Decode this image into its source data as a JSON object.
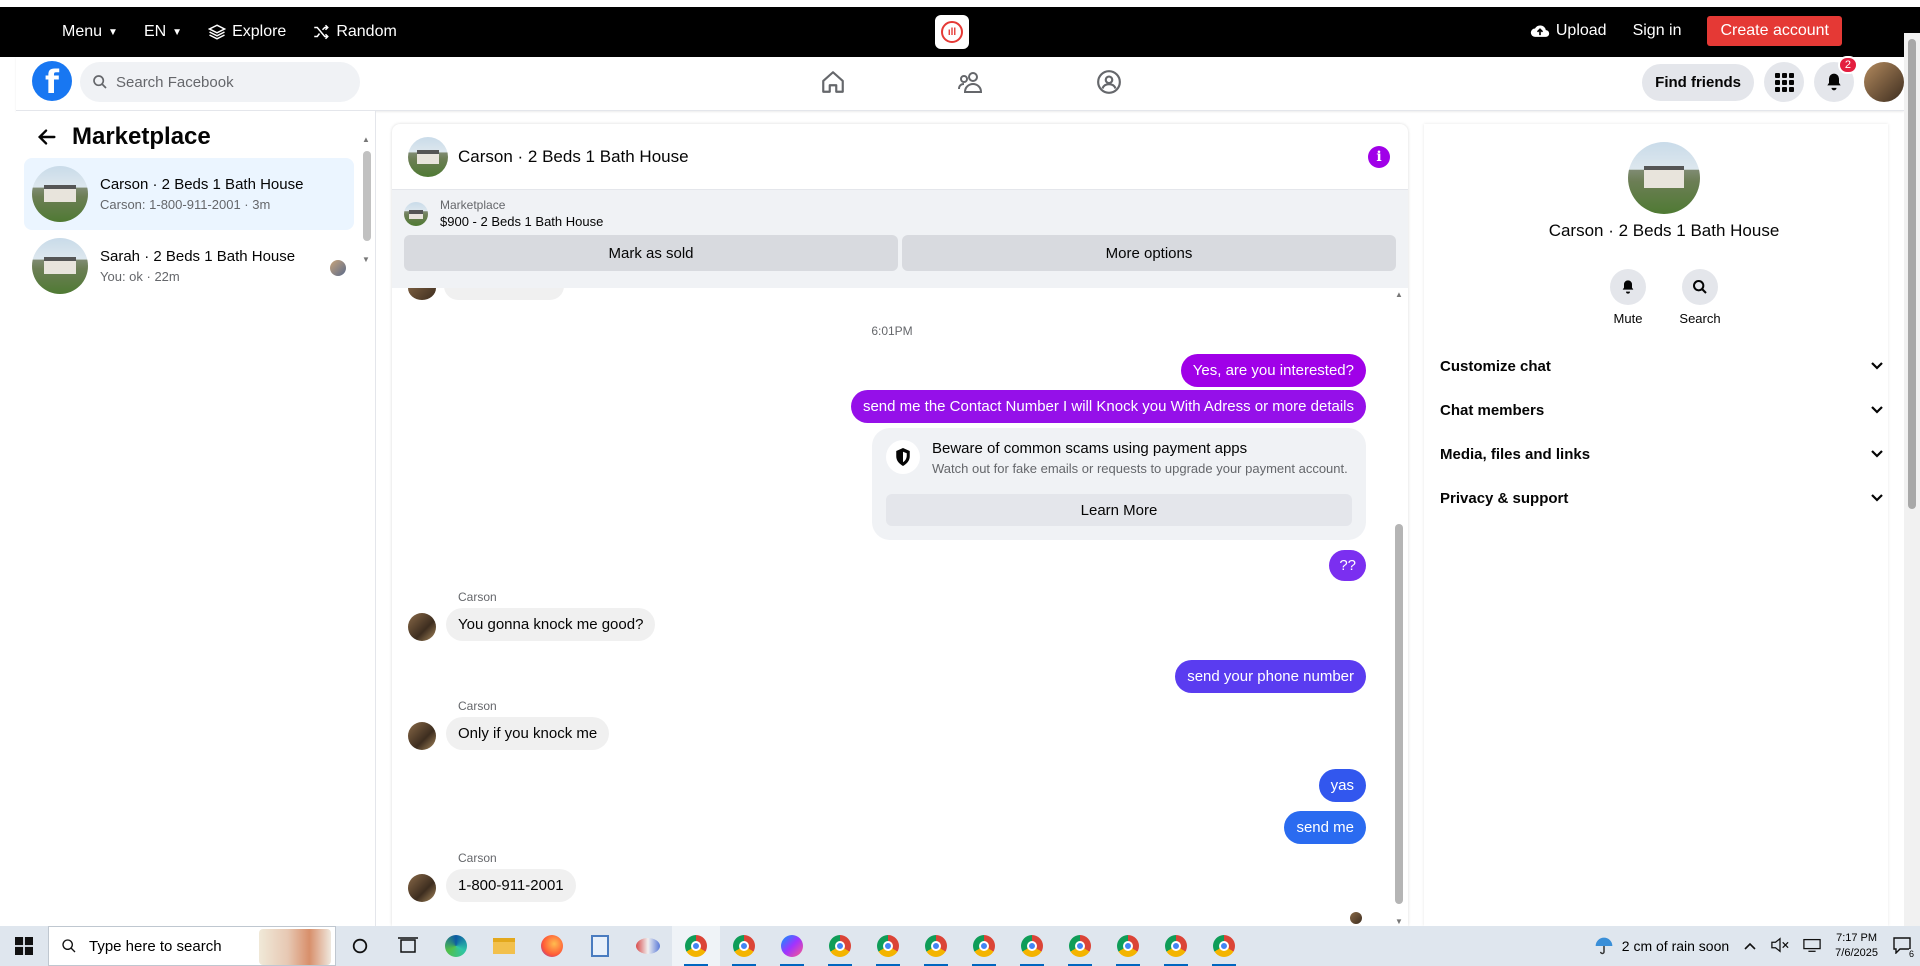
{
  "topbar": {
    "menu": "Menu",
    "lang": "EN",
    "explore": "Explore",
    "random": "Random",
    "upload": "Upload",
    "signin": "Sign in",
    "create": "Create account"
  },
  "fb": {
    "search_placeholder": "Search Facebook",
    "find_friends": "Find friends",
    "notif_count": "2"
  },
  "left": {
    "title": "Marketplace",
    "conversations": [
      {
        "name": "Carson · 2 Beds 1 Bath House",
        "sub": "Carson: 1-800-911-2001 · 3m"
      },
      {
        "name": "Sarah · 2 Beds 1 Bath House",
        "sub": "You: ok · 22m"
      }
    ]
  },
  "chat": {
    "title": "Carson · 2 Beds 1 Bath House",
    "marketplace_label": "Marketplace",
    "listing": "$900 - 2 Beds 1 Bath House",
    "mark_sold": "Mark as sold",
    "more_options": "More options",
    "time": "6:01PM",
    "messages": [
      {
        "from": "me",
        "text": "Yes, are you interested?"
      },
      {
        "from": "me",
        "text": "send me the Contact Number I will Knock you With Adress or more details"
      },
      {
        "from": "me",
        "text": "??"
      },
      {
        "from": "Carson",
        "text": "You gonna knock me good?"
      },
      {
        "from": "me",
        "text": "send your phone number"
      },
      {
        "from": "Carson",
        "text": "Only if you knock me"
      },
      {
        "from": "me",
        "text": "yas"
      },
      {
        "from": "me",
        "text": "send me"
      },
      {
        "from": "Carson",
        "text": "1-800-911-2001"
      }
    ],
    "scam_title": "Beware of common scams using payment apps",
    "scam_body": "Watch out for fake emails or requests to upgrade your payment account.",
    "learn_more": "Learn More"
  },
  "right": {
    "name": "Carson · 2 Beds 1 Bath House",
    "mute": "Mute",
    "search": "Search",
    "sections": [
      "Customize chat",
      "Chat members",
      "Media, files and links",
      "Privacy & support"
    ]
  },
  "taskbar": {
    "search_placeholder": "Type here to search",
    "weather": "2 cm of rain soon",
    "time": "7:17 PM",
    "date": "7/6/2025",
    "notif_count": "6"
  },
  "colors": {
    "purple": "#a000e8",
    "violet": "#7b3bf0",
    "indigo": "#4a4ae8",
    "blue": "#2a6bf0",
    "fb_blue": "#1877f2",
    "create_red": "#e53935"
  }
}
